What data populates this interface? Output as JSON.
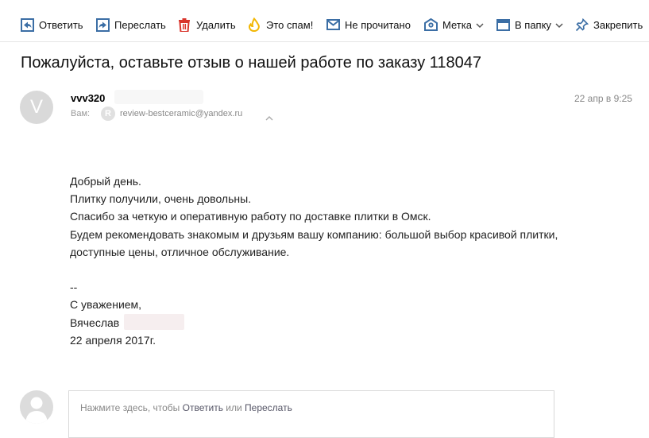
{
  "toolbar": {
    "items": [
      {
        "label": "Ответить",
        "icon": "reply-icon"
      },
      {
        "label": "Переслать",
        "icon": "forward-icon"
      },
      {
        "label": "Удалить",
        "icon": "trash-icon"
      },
      {
        "label": "Это спам!",
        "icon": "spam-icon"
      },
      {
        "label": "Не прочитано",
        "icon": "envelope-icon"
      },
      {
        "label": "Метка",
        "icon": "label-icon"
      },
      {
        "label": "В папку",
        "icon": "folder-icon"
      },
      {
        "label": "Закрепить",
        "icon": "pin-icon"
      }
    ]
  },
  "message": {
    "subject": "Пожалуйста, оставьте отзыв о нашей работе по заказу 118047",
    "avatar_letter": "V",
    "sender_name": "vvv320",
    "to_label": "Вам:",
    "to_icon_letter": "R",
    "to_address": "review-bestceramic@yandex.ru",
    "date": "22 апр в 9:25",
    "body_lines": [
      "Добрый день.",
      "Плитку получили, очень довольны.",
      "Спасибо за четкую и оперативную работу по доставке плитки в Омск.",
      "Будем рекомендовать знакомым и друзьям вашу компанию: большой выбор красивой плитки,",
      "доступные цены, отличное обслуживание.",
      "",
      "--",
      "С уважением,",
      "Вячеслав",
      "22 апреля 2017г."
    ]
  },
  "reply": {
    "prefix": "Нажмите здесь, чтобы ",
    "reply_link": "Ответить",
    "middle": " или ",
    "forward_link": "Переслать"
  },
  "colors": {
    "icon_blue": "#3b6ea5",
    "delete_red": "#d9342b",
    "spam_yellow": "#f2b705"
  }
}
